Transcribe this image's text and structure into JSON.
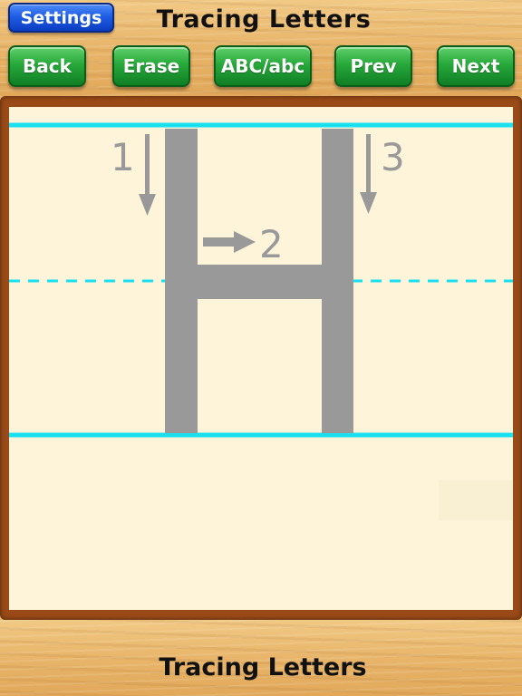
{
  "header": {
    "settings_label": "Settings",
    "title": "Tracing Letters"
  },
  "toolbar": {
    "back_label": "Back",
    "erase_label": "Erase",
    "case_label": "ABC/abc",
    "prev_label": "Prev",
    "next_label": "Next"
  },
  "tracing": {
    "letter": "H",
    "stroke_numbers": [
      "1",
      "2",
      "3"
    ],
    "guide_line_color": "#19e0f0",
    "letter_color": "#999999",
    "paper_color": "#fdf4da",
    "frame_color": "#9a4a17"
  },
  "footer": {
    "title": "Tracing Letters"
  },
  "colors": {
    "settings_button": "#1f5de6",
    "toolbar_button": "#27a93a",
    "wood": "#e8b56a"
  }
}
